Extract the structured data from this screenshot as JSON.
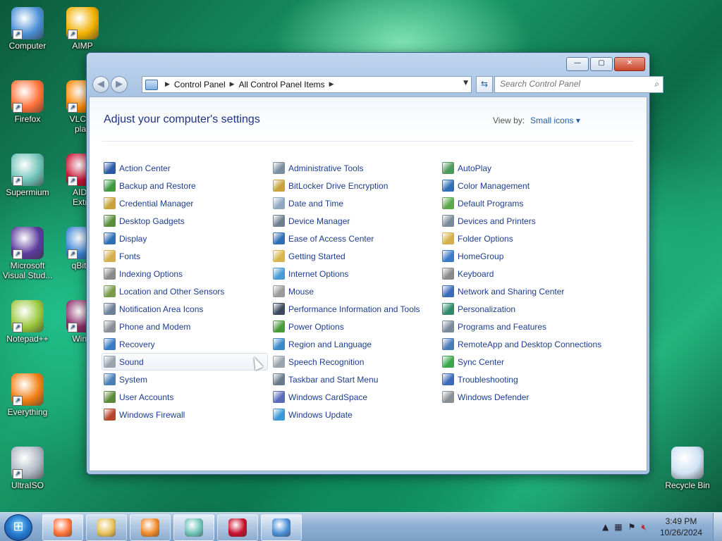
{
  "desktop": {
    "icons": [
      {
        "label": "Computer",
        "icon": "computer-icon",
        "color": "#4a8fd6"
      },
      {
        "label": "AIMP",
        "icon": "aimp-icon",
        "color": "#f1b000"
      },
      {
        "label": "Firefox",
        "icon": "firefox-icon",
        "color": "#ff7139"
      },
      {
        "label": "VLC m\nplay",
        "icon": "vlc-icon",
        "color": "#ff8800"
      },
      {
        "label": "Supermium",
        "icon": "supermium-icon",
        "color": "#6fc3b8"
      },
      {
        "label": "AIDA\nExtre",
        "icon": "aida64-icon",
        "color": "#c8102e"
      },
      {
        "label": "Microsoft\nVisual Stud...",
        "icon": "visual-studio-icon",
        "color": "#5b3a9c"
      },
      {
        "label": "qBitto",
        "icon": "qbittorrent-icon",
        "color": "#3b83d6"
      },
      {
        "label": "Notepad++",
        "icon": "notepadpp-icon",
        "color": "#9bc83d"
      },
      {
        "label": "WinR",
        "icon": "winrar-icon",
        "color": "#8a2b6b"
      },
      {
        "label": "Everything",
        "icon": "everything-icon",
        "color": "#f07f13"
      },
      {
        "label": "UltraISO",
        "icon": "ultraiso-icon",
        "color": "#b0b8c4"
      },
      {
        "label": "Recycle Bin",
        "icon": "recycle-bin-icon",
        "color": "#cfe2f3"
      }
    ]
  },
  "window": {
    "breadcrumb": [
      "Control Panel",
      "All Control Panel Items"
    ],
    "search_placeholder": "Search Control Panel",
    "controls": {
      "minimize": "—",
      "maximize": "▢",
      "close": "✕"
    },
    "title": "Adjust your computer's settings",
    "view_by_label": "View by:",
    "view_by_value": "Small icons ▾"
  },
  "items": {
    "col1": [
      {
        "label": "Action Center",
        "color": "#2a5aa8"
      },
      {
        "label": "Backup and Restore",
        "color": "#3f9a3f"
      },
      {
        "label": "Credential Manager",
        "color": "#c9a23a"
      },
      {
        "label": "Desktop Gadgets",
        "color": "#5a8e3a"
      },
      {
        "label": "Display",
        "color": "#2f6fb5"
      },
      {
        "label": "Fonts",
        "color": "#d4b04a"
      },
      {
        "label": "Indexing Options",
        "color": "#8a8a8a"
      },
      {
        "label": "Location and Other Sensors",
        "color": "#7a9a4a"
      },
      {
        "label": "Notification Area Icons",
        "color": "#6d7f96"
      },
      {
        "label": "Phone and Modem",
        "color": "#8a8f96"
      },
      {
        "label": "Recovery",
        "color": "#3a7bc8"
      },
      {
        "label": "Sound",
        "color": "#9aa4ae"
      },
      {
        "label": "System",
        "color": "#4a7fb8"
      },
      {
        "label": "User Accounts",
        "color": "#5d8a3a"
      },
      {
        "label": "Windows Firewall",
        "color": "#b8462c"
      }
    ],
    "col2": [
      {
        "label": "Administrative Tools",
        "color": "#7a8e9e"
      },
      {
        "label": "BitLocker Drive Encryption",
        "color": "#c9a23a"
      },
      {
        "label": "Date and Time",
        "color": "#8fa8c2"
      },
      {
        "label": "Device Manager",
        "color": "#6f7f90"
      },
      {
        "label": "Ease of Access Center",
        "color": "#2f6fb5"
      },
      {
        "label": "Getting Started",
        "color": "#d8b54a"
      },
      {
        "label": "Internet Options",
        "color": "#4a9ad6"
      },
      {
        "label": "Mouse",
        "color": "#9a9a9a"
      },
      {
        "label": "Performance Information and Tools",
        "color": "#3a4a5a"
      },
      {
        "label": "Power Options",
        "color": "#4a9a3a"
      },
      {
        "label": "Region and Language",
        "color": "#3a8ac8"
      },
      {
        "label": "Speech Recognition",
        "color": "#9aa4ae"
      },
      {
        "label": "Taskbar and Start Menu",
        "color": "#6a7a8a"
      },
      {
        "label": "Windows CardSpace",
        "color": "#5a6ab8"
      },
      {
        "label": "Windows Update",
        "color": "#3a9ad6"
      }
    ],
    "col3": [
      {
        "label": "AutoPlay",
        "color": "#4a9a5a"
      },
      {
        "label": "Color Management",
        "color": "#2f6fb5"
      },
      {
        "label": "Default Programs",
        "color": "#5aa84a"
      },
      {
        "label": "Devices and Printers",
        "color": "#7a8a9a"
      },
      {
        "label": "Folder Options",
        "color": "#d4b04a"
      },
      {
        "label": "HomeGroup",
        "color": "#3a7ac8"
      },
      {
        "label": "Keyboard",
        "color": "#8a8a8a"
      },
      {
        "label": "Network and Sharing Center",
        "color": "#3a6ab8"
      },
      {
        "label": "Personalization",
        "color": "#2f8a6a"
      },
      {
        "label": "Programs and Features",
        "color": "#7a8a9a"
      },
      {
        "label": "RemoteApp and Desktop Connections",
        "color": "#4a7ab8"
      },
      {
        "label": "Sync Center",
        "color": "#3aa84a"
      },
      {
        "label": "Troubleshooting",
        "color": "#3a6ab8"
      },
      {
        "label": "Windows Defender",
        "color": "#8a8f96"
      }
    ]
  },
  "taskbar": {
    "start_icon": "windows-logo-icon",
    "buttons": [
      {
        "name": "taskbar-firefox-button",
        "icon": "firefox-icon",
        "color": "#ff7139"
      },
      {
        "name": "taskbar-explorer-button",
        "icon": "folder-icon",
        "color": "#e8c15a"
      },
      {
        "name": "taskbar-media-player-button",
        "icon": "media-player-icon",
        "color": "#f08a2a"
      },
      {
        "name": "taskbar-supermium-button",
        "icon": "supermium-icon",
        "color": "#6fc3b8"
      },
      {
        "name": "taskbar-aida64-button",
        "icon": "aida64-icon",
        "color": "#c8102e"
      },
      {
        "name": "taskbar-control-panel-button",
        "icon": "control-panel-icon",
        "color": "#4a8fd6"
      }
    ],
    "time": "3:49 PM",
    "date": "10/26/2024"
  }
}
